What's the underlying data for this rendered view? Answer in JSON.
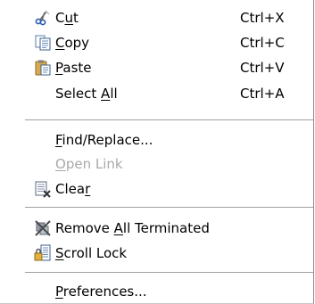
{
  "menu": {
    "items": [
      {
        "key": "cut",
        "pre": "C",
        "mn": "u",
        "post": "t",
        "shortcut": "Ctrl+X",
        "icon": "scissors-icon"
      },
      {
        "key": "copy",
        "pre": "",
        "mn": "C",
        "post": "opy",
        "shortcut": "Ctrl+C",
        "icon": "copy-icon"
      },
      {
        "key": "paste",
        "pre": "",
        "mn": "P",
        "post": "aste",
        "shortcut": "Ctrl+V",
        "icon": "clipboard-icon"
      },
      {
        "key": "select_all",
        "pre": "Select ",
        "mn": "A",
        "post": "ll",
        "shortcut": "Ctrl+A"
      },
      {
        "key": "find_replace",
        "pre": "",
        "mn": "F",
        "post": "ind/Replace..."
      },
      {
        "key": "open_link",
        "pre": "",
        "mn": "O",
        "post": "pen Link",
        "disabled": true
      },
      {
        "key": "clear",
        "pre": "Clea",
        "mn": "r",
        "post": "",
        "icon": "clear-console-icon"
      },
      {
        "key": "remove_all_terminated",
        "pre": "Remove ",
        "mn": "A",
        "post": "ll Terminated",
        "icon": "remove-terminated-icon"
      },
      {
        "key": "scroll_lock",
        "pre": "",
        "mn": "S",
        "post": "croll Lock",
        "icon": "scroll-lock-icon"
      },
      {
        "key": "preferences",
        "pre": "",
        "mn": "P",
        "post": "references..."
      }
    ]
  }
}
